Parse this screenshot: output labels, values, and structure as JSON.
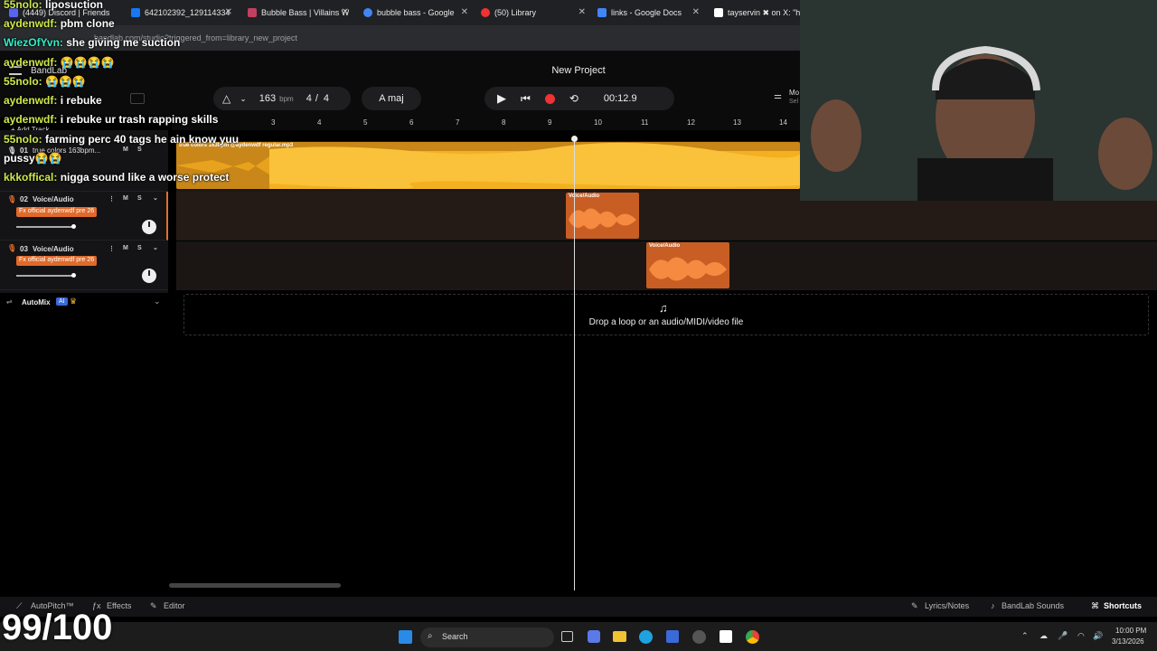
{
  "browser": {
    "tabs": [
      {
        "label": "(4449) Discord | Friends",
        "color": "#5865f2"
      },
      {
        "label": "642102392_129114334",
        "color": "#1877f2"
      },
      {
        "label": "Bubble Bass | Villains W",
        "color": "#c04060"
      },
      {
        "label": "bubble bass - Google",
        "color": "#4285f4"
      },
      {
        "label": "(50) Library",
        "color": "#e33"
      },
      {
        "label": "links - Google Docs",
        "color": "#4285f4"
      },
      {
        "label": "tayservin ✖ on X: \"ht",
        "color": "#000"
      }
    ],
    "url": "bandlab.com/studio?triggered_from=library_new_project"
  },
  "daw": {
    "project_title": "New Project",
    "tempo": "163",
    "tempo_unit": "bpm",
    "time_sig_num": "4",
    "time_sig_den": "4",
    "key": "A maj",
    "time": "00:12.9",
    "add_track": "+ Add Track",
    "mixer_label": "Mo",
    "mixer_sub": "Sel",
    "ruler": [
      "3",
      "4",
      "5",
      "6",
      "7",
      "8",
      "9",
      "10",
      "11",
      "12",
      "13",
      "14"
    ],
    "tracks": [
      {
        "num": "01",
        "name": "true colors 163bpm...",
        "fx": "",
        "m": "M",
        "s": "S"
      },
      {
        "num": "02",
        "name": "Voice/Audio",
        "fx": "Fx official aydenwdf pre 26",
        "m": "M",
        "s": "S"
      },
      {
        "num": "03",
        "name": "Voice/Audio",
        "fx": "Fx official aydenwdf pre 26",
        "m": "M",
        "s": "S"
      }
    ],
    "regions": {
      "beat_label": "true colors 163bpm @aydenwdf regular.mp3",
      "vocal1_label": "Voice/Audio",
      "vocal2_label": "Voice/Audio"
    },
    "automix": "AutoMix",
    "automix_badge": "AI",
    "drop_text": "Drop a loop or an audio/MIDI/video file",
    "bottom": {
      "autopitch": "AutoPitch™",
      "effects": "Effects",
      "editor": "Editor",
      "lyrics": "Lyrics/Notes",
      "sounds": "BandLab Sounds",
      "shortcuts": "Shortcuts"
    },
    "colors": {
      "beat": "#f0a020",
      "vocal": "#e3702a"
    }
  },
  "taskbar": {
    "search": "Search",
    "clock_time": "10:00 PM",
    "clock_date": "3/13/2026"
  },
  "overlay": {
    "chat": [
      {
        "user": "55nolo:",
        "msg": "liposuction",
        "cls": "u"
      },
      {
        "user": "aydenwdf:",
        "msg": "pbm clone",
        "cls": "u"
      },
      {
        "user": "WiezOfYvn:",
        "msg": "she giving me suction",
        "cls": "u2"
      },
      {
        "user": "aydenwdf:",
        "msg": "😭😭😭😭",
        "cls": "u"
      },
      {
        "user": "55nolo:",
        "msg": "😭😭😭",
        "cls": "u"
      },
      {
        "user": "aydenwdf:",
        "msg": "i rebuke",
        "cls": "u"
      },
      {
        "user": "aydenwdf:",
        "msg": "i rebuke ur trash rapping skills",
        "cls": "u"
      },
      {
        "user": "55nolo:",
        "msg": "farming perc 40 tags he ain know yuu",
        "cls": "u"
      },
      {
        "user": "",
        "msg": "pussy😭😭",
        "cls": "u"
      },
      {
        "user": "kkkoffical:",
        "msg": "nigga sound like a worse protect",
        "cls": "u"
      }
    ],
    "score": "99/100",
    "bandlab_label": "BandLab"
  }
}
